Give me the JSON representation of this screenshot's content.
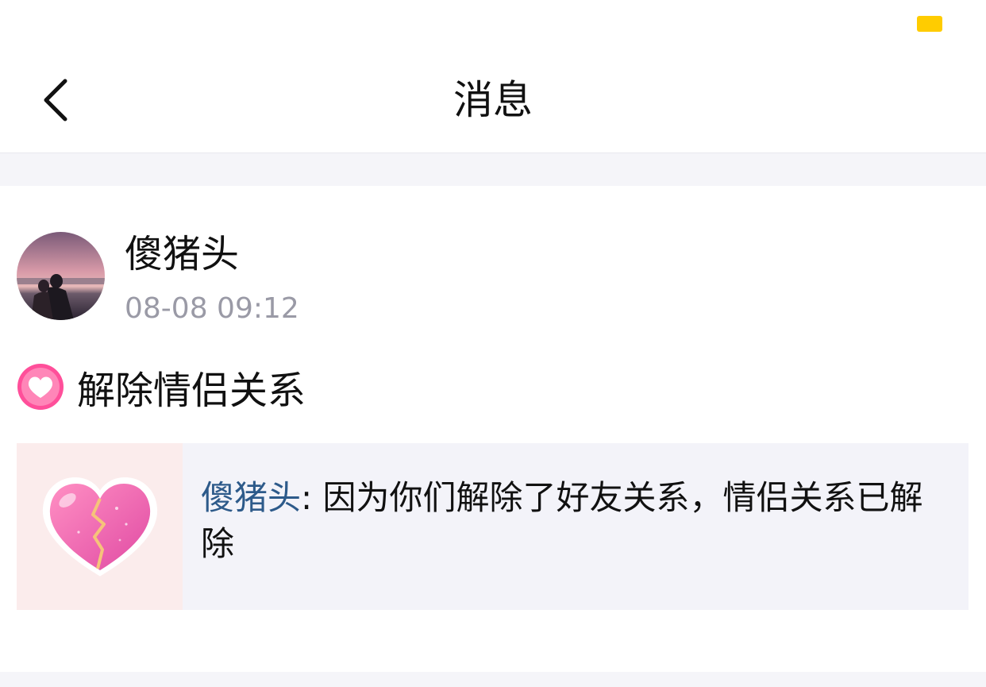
{
  "status_bar": {
    "battery_color": "#ffcc00"
  },
  "nav": {
    "back_icon": "chevron-left-icon",
    "title": "消息"
  },
  "post": {
    "username": "傻猪头",
    "timestamp": "08-08 09:12",
    "notice_icon": "heart-badge-icon",
    "notice_text": "解除情侣关系"
  },
  "message": {
    "thumb_icon": "broken-heart-icon",
    "author": "傻猪头",
    "separator": ": ",
    "text": "因为你们解除了好友关系，情侣关系已解除"
  },
  "colors": {
    "accent_pink": "#ff4f9a",
    "author_link": "#2d5a8a",
    "timestamp_gray": "#9a9aa6"
  }
}
